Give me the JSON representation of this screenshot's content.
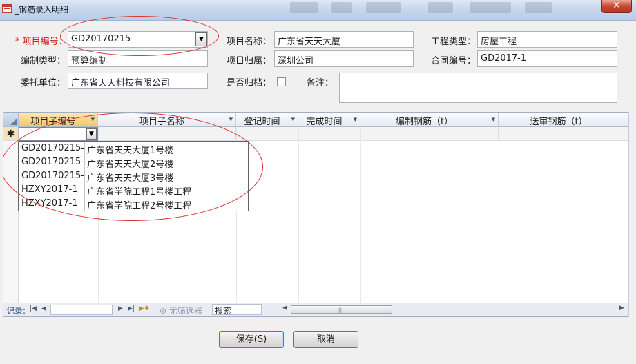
{
  "window": {
    "title": "_钢筋录入明细",
    "close_glyph": "✕"
  },
  "form": {
    "project_no": {
      "label": "项目编号：",
      "value": "GD20170215"
    },
    "project_name": {
      "label": "项目名称：",
      "value": "广东省天天大厦"
    },
    "project_type": {
      "label": "工程类型：",
      "value": "房屋工程"
    },
    "prep_type": {
      "label": "编制类型：",
      "value": "预算编制"
    },
    "belongs_to": {
      "label": "项目归属：",
      "value": "深圳公司"
    },
    "contract_no": {
      "label": "合同编号：",
      "value": "GD2017-1"
    },
    "client": {
      "label": "委托单位：",
      "value": "广东省天天科技有限公司"
    },
    "archived": {
      "label": "是否归档：",
      "checked": false
    },
    "remarks": {
      "label": "备注：",
      "value": ""
    }
  },
  "grid": {
    "columns": [
      "项目子编号",
      "项目子名称",
      "登记时间",
      "完成时间",
      "编制钢筋（t）",
      "送审钢筋（t）"
    ],
    "new_row_marker": "✱",
    "dropdown_rows": [
      {
        "code": "GD20170215-",
        "name": "广东省天天大厦1号楼"
      },
      {
        "code": "GD20170215-",
        "name": "广东省天天大厦2号楼"
      },
      {
        "code": "GD20170215-",
        "name": "广东省天天大厦3号楼"
      },
      {
        "code": "HZXY2017-1",
        "name": "广东省学院工程1号楼工程"
      },
      {
        "code": "HZXY2017-1",
        "name": "广东省学院工程2号楼工程"
      }
    ]
  },
  "nav": {
    "records_label": "记录:",
    "first": "|◀",
    "prev": "◀",
    "next": "▶",
    "last": "▶|",
    "new": "▶✱",
    "filter_label": "无筛选器",
    "search_label": "搜索"
  },
  "buttons": {
    "save": "保存(S)",
    "cancel": "取消"
  },
  "icons": {
    "dropdown": "▼",
    "scroll_left": "◀",
    "scroll_right": "▶",
    "grip": "|||"
  },
  "colors": {
    "required_label": "#d12020",
    "annotation_ellipse": "#e03030",
    "active_header": "#f6c46a"
  }
}
